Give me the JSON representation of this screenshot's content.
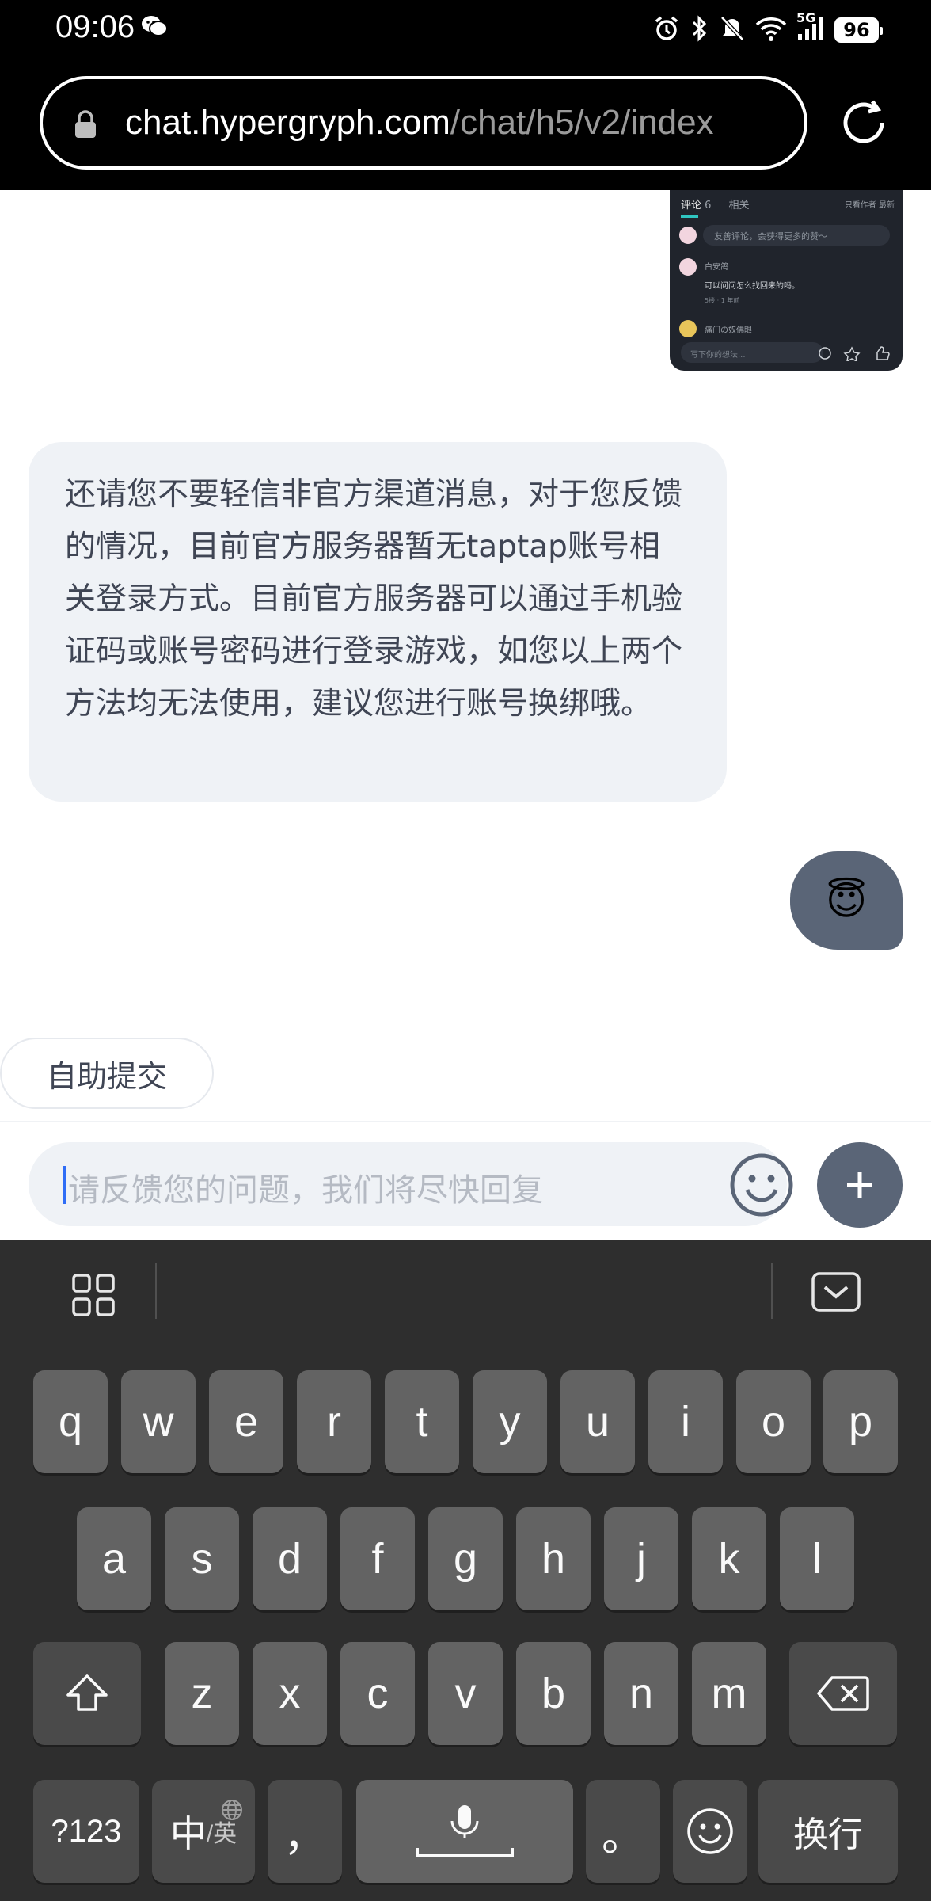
{
  "status_bar": {
    "time": "09:06",
    "network": "5G",
    "battery": "96",
    "icons": [
      "wechat-icon",
      "alarm-icon",
      "bluetooth-icon",
      "mute-icon",
      "wifi-icon",
      "signal-icon",
      "battery-icon"
    ]
  },
  "browser": {
    "url_host": "chat.hypergryph.com",
    "url_path": "/chat/h5/v2/index"
  },
  "screenshot_thumb": {
    "tab_comments": "评论",
    "tab_comments_count": "6",
    "tab_related": "相关",
    "tabs_right": "只看作者   最新",
    "comment_placeholder": "友善评论，会获得更多的赞～",
    "comment1_user": "白安鸽",
    "comment1_text": "可以问问怎么找回来的吗。",
    "comment1_meta": "5楼 · 1 年前",
    "comment2_user": "痛门の奴佛眼",
    "bottom_placeholder": "写下你的想法..."
  },
  "messages": {
    "incoming_text": "还请您不要轻信非官方渠道消息，对于您反馈的情况，目前官方服务器暂无taptap账号相关登录方式。目前官方服务器可以通过手机验证码或账号密码进行登录游戏，如您以上两个方法均无法使用，建议您进行账号换绑哦。",
    "outgoing_emoji": "😇"
  },
  "quick_action": {
    "label": "自助提交"
  },
  "input": {
    "placeholder": "请反馈您的问题，我们将尽快回复"
  },
  "keyboard": {
    "row1": [
      "q",
      "w",
      "e",
      "r",
      "t",
      "y",
      "u",
      "i",
      "o",
      "p"
    ],
    "row2": [
      "a",
      "s",
      "d",
      "f",
      "g",
      "h",
      "j",
      "k",
      "l"
    ],
    "row3": [
      "z",
      "x",
      "c",
      "v",
      "b",
      "n",
      "m"
    ],
    "key_123": "?123",
    "key_zh": "中",
    "key_en": "/英",
    "key_comma": "，",
    "key_period": "。",
    "key_return": "换行"
  },
  "colors": {
    "accent": "#5a6577",
    "bubble_in": "#eff2f6",
    "keyboard_bg": "#2e2e2e",
    "key_bg": "#636363",
    "caret": "#2f6df6"
  }
}
